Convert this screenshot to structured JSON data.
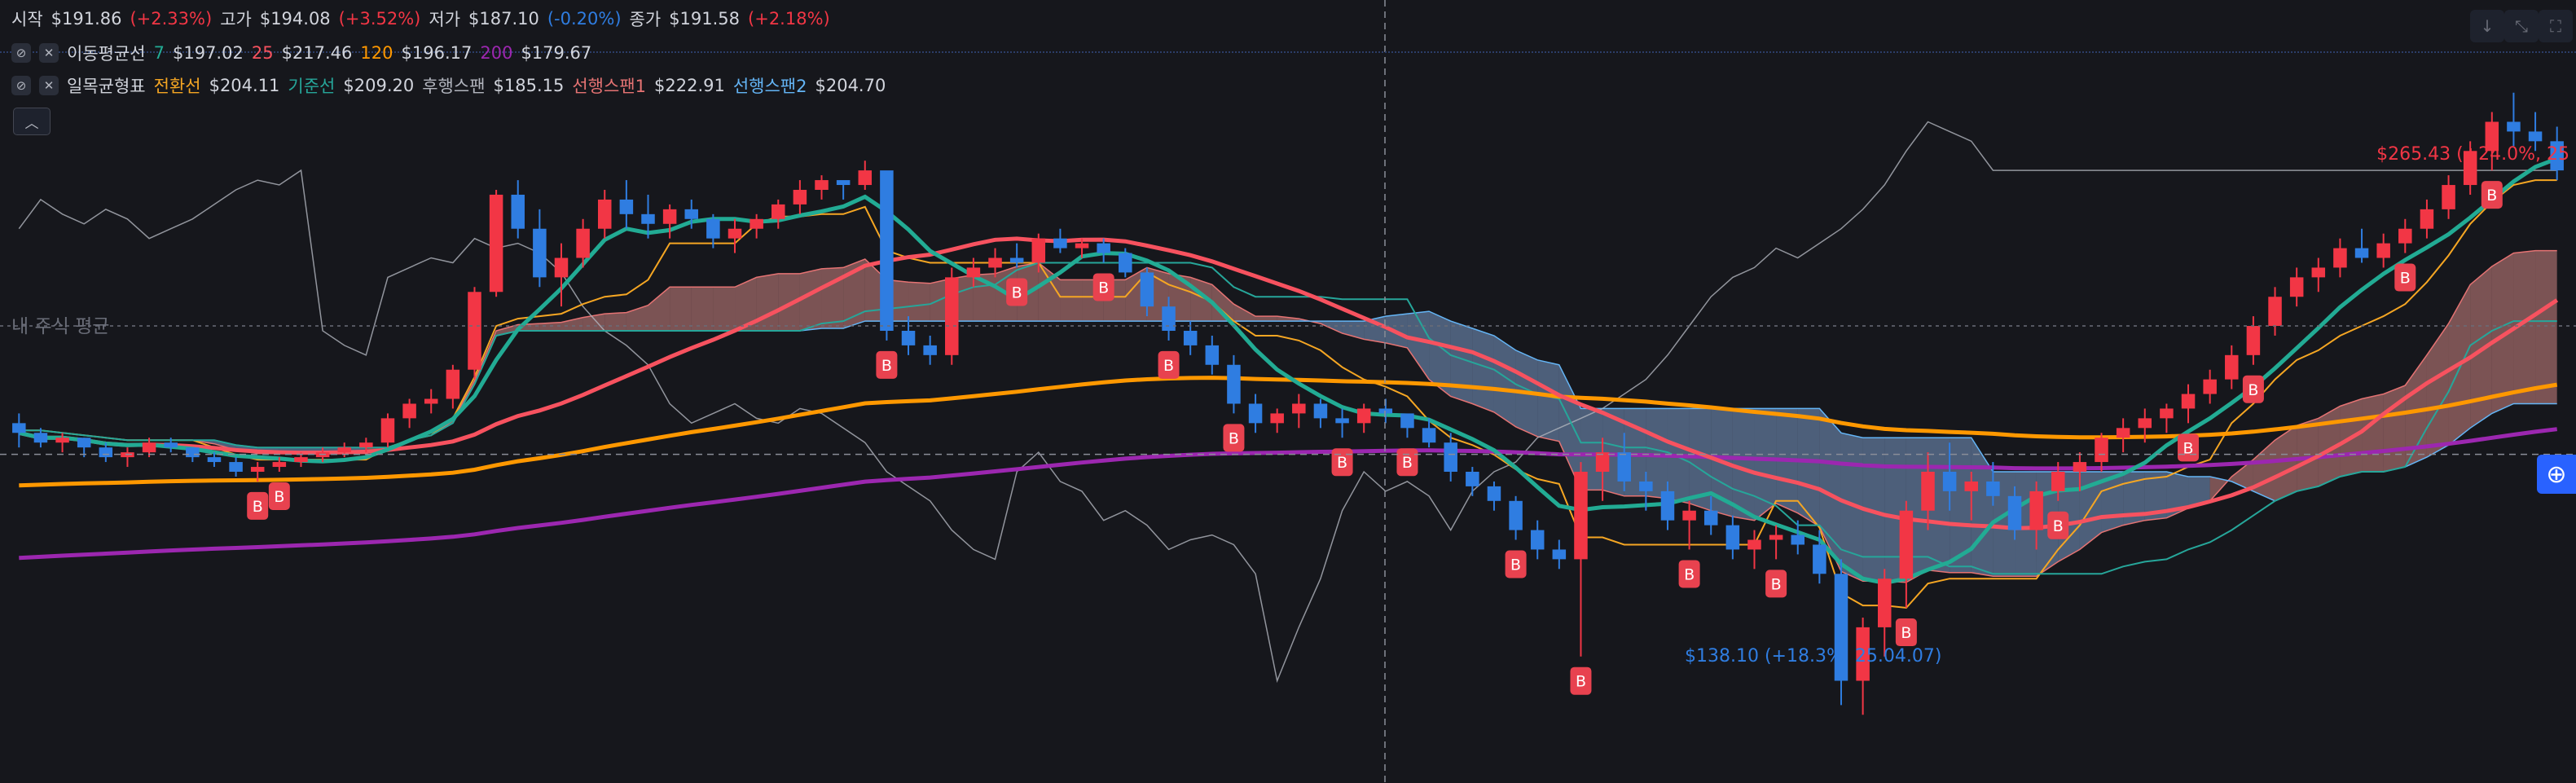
{
  "ohlc": {
    "open_label": "시작",
    "open": "$191.86",
    "open_pct": "(+2.33%)",
    "high_label": "고가",
    "high": "$194.08",
    "high_pct": "(+3.52%)",
    "low_label": "저가",
    "low": "$187.10",
    "low_pct": "(-0.20%)",
    "close_label": "종가",
    "close": "$191.58",
    "close_pct": "(+2.18%)"
  },
  "ma": {
    "name": "이동평균선",
    "p1": "7",
    "v1": "$197.02",
    "p2": "25",
    "v2": "$217.46",
    "p3": "120",
    "v3": "$196.17",
    "p4": "200",
    "v4": "$179.67"
  },
  "ichimoku": {
    "name": "일목균형표",
    "conv_label": "전환선",
    "conv": "$204.11",
    "base_label": "기준선",
    "base": "$209.20",
    "lag_label": "후행스팬",
    "lag": "$185.15",
    "spanA_label": "선행스팬1",
    "spanA": "$222.91",
    "spanB_label": "선행스팬2",
    "spanB": "$204.70"
  },
  "icons": {
    "hide": "eye-off-icon",
    "remove": "close-icon",
    "collapse": "chevron-up-icon",
    "down": "arrow-down-icon",
    "compress": "compress-icon",
    "fullscreen": "fullscreen-icon",
    "add": "plus-icon"
  },
  "annotations": {
    "avg_label": "내 주식 평균",
    "high_marker": "$265.43 (+24.0%, 25",
    "low_marker": "$138.10 (+18.3%, 25.04.07)",
    "buy_marker": "B"
  },
  "colors": {
    "up": "#f23645",
    "down": "#2f7de1",
    "ma7": "#22ab94",
    "ma25": "#f7525f",
    "ma120": "#ff9800",
    "ma200": "#9c27b0",
    "conversion": "#f5a623",
    "base": "#26a69a",
    "lagging": "#b2b5be",
    "spanA_cloud": "#d08584",
    "spanB_cloud": "#7b9ac8"
  },
  "chart_data": {
    "type": "candlestick",
    "ylim": [
      130,
      275
    ],
    "avg_price": 218.0,
    "current_price": 191.58,
    "candles": [
      [
        198,
        200,
        193,
        196
      ],
      [
        196,
        197,
        193,
        194
      ],
      [
        194,
        196,
        192,
        195
      ],
      [
        195,
        195,
        191,
        193
      ],
      [
        193,
        194,
        190,
        191
      ],
      [
        191,
        193,
        189,
        192
      ],
      [
        192,
        195,
        191,
        194
      ],
      [
        194,
        195,
        192,
        193
      ],
      [
        193,
        193,
        190,
        191
      ],
      [
        191,
        192,
        189,
        190
      ],
      [
        190,
        191,
        187,
        188
      ],
      [
        188,
        190,
        186,
        189
      ],
      [
        189,
        191,
        188,
        190
      ],
      [
        190,
        192,
        189,
        191
      ],
      [
        191,
        193,
        190,
        192
      ],
      [
        192,
        194,
        191,
        193
      ],
      [
        193,
        195,
        192,
        194
      ],
      [
        194,
        200,
        193,
        199
      ],
      [
        199,
        203,
        197,
        202
      ],
      [
        202,
        205,
        200,
        203
      ],
      [
        203,
        210,
        201,
        209
      ],
      [
        209,
        226,
        207,
        225
      ],
      [
        225,
        246,
        224,
        245
      ],
      [
        245,
        248,
        236,
        238
      ],
      [
        238,
        242,
        226,
        228
      ],
      [
        228,
        235,
        222,
        232
      ],
      [
        232,
        240,
        230,
        238
      ],
      [
        238,
        246,
        236,
        244
      ],
      [
        244,
        248,
        238,
        241
      ],
      [
        241,
        245,
        236,
        239
      ],
      [
        239,
        243,
        236,
        242
      ],
      [
        242,
        244,
        238,
        240
      ],
      [
        240,
        241,
        234,
        236
      ],
      [
        236,
        240,
        233,
        238
      ],
      [
        238,
        241,
        236,
        240
      ],
      [
        240,
        244,
        238,
        243
      ],
      [
        243,
        248,
        241,
        246
      ],
      [
        246,
        249,
        244,
        248
      ],
      [
        248,
        247,
        244,
        247
      ],
      [
        247,
        252,
        246,
        250
      ],
      [
        250,
        224,
        215,
        217
      ],
      [
        217,
        220,
        212,
        214
      ],
      [
        214,
        216,
        210,
        212
      ],
      [
        212,
        230,
        210,
        228
      ],
      [
        228,
        232,
        226,
        230
      ],
      [
        230,
        234,
        228,
        232
      ],
      [
        232,
        235,
        230,
        231
      ],
      [
        231,
        237,
        229,
        236
      ],
      [
        236,
        238,
        233,
        234
      ],
      [
        234,
        236,
        232,
        235
      ],
      [
        235,
        236,
        231,
        233
      ],
      [
        233,
        234,
        228,
        229
      ],
      [
        229,
        230,
        220,
        222
      ],
      [
        222,
        224,
        215,
        217
      ],
      [
        217,
        219,
        212,
        214
      ],
      [
        214,
        216,
        208,
        210
      ],
      [
        210,
        212,
        200,
        202
      ],
      [
        202,
        204,
        196,
        198
      ],
      [
        198,
        201,
        196,
        200
      ],
      [
        200,
        204,
        197,
        202
      ],
      [
        202,
        203,
        197,
        199
      ],
      [
        199,
        201,
        195,
        198
      ],
      [
        198,
        202,
        196,
        201
      ],
      [
        201,
        203,
        198,
        200
      ],
      [
        200,
        199,
        195,
        197
      ],
      [
        197,
        199,
        193,
        194
      ],
      [
        194,
        196,
        186,
        188
      ],
      [
        188,
        189,
        183,
        185
      ],
      [
        185,
        186,
        180,
        182
      ],
      [
        182,
        183,
        174,
        176
      ],
      [
        176,
        178,
        170,
        172
      ],
      [
        172,
        174,
        168,
        170
      ],
      [
        170,
        190,
        150,
        188
      ],
      [
        188,
        195,
        182,
        192
      ],
      [
        192,
        196,
        184,
        186
      ],
      [
        186,
        188,
        180,
        184
      ],
      [
        184,
        186,
        176,
        178
      ],
      [
        178,
        182,
        172,
        180
      ],
      [
        180,
        183,
        175,
        177
      ],
      [
        177,
        179,
        170,
        172
      ],
      [
        172,
        176,
        168,
        174
      ],
      [
        174,
        177,
        170,
        175
      ],
      [
        175,
        178,
        171,
        173
      ],
      [
        173,
        176,
        165,
        167
      ],
      [
        167,
        170,
        140,
        145
      ],
      [
        145,
        158,
        138,
        156
      ],
      [
        156,
        168,
        150,
        166
      ],
      [
        166,
        182,
        160,
        180
      ],
      [
        180,
        192,
        176,
        188
      ],
      [
        188,
        194,
        180,
        184
      ],
      [
        184,
        188,
        178,
        186
      ],
      [
        186,
        190,
        181,
        183
      ],
      [
        183,
        185,
        174,
        176
      ],
      [
        176,
        186,
        172,
        184
      ],
      [
        184,
        190,
        182,
        188
      ],
      [
        188,
        192,
        184,
        190
      ],
      [
        190,
        196,
        188,
        195
      ],
      [
        195,
        199,
        192,
        197
      ],
      [
        197,
        201,
        194,
        199
      ],
      [
        199,
        202,
        196,
        201
      ],
      [
        201,
        206,
        198,
        204
      ],
      [
        204,
        209,
        202,
        207
      ],
      [
        207,
        214,
        205,
        212
      ],
      [
        212,
        220,
        210,
        218
      ],
      [
        218,
        226,
        216,
        224
      ],
      [
        224,
        230,
        222,
        228
      ],
      [
        228,
        232,
        225,
        230
      ],
      [
        230,
        236,
        228,
        234
      ],
      [
        234,
        238,
        231,
        232
      ],
      [
        232,
        237,
        230,
        235
      ],
      [
        235,
        240,
        233,
        238
      ],
      [
        238,
        244,
        236,
        242
      ],
      [
        242,
        249,
        240,
        247
      ],
      [
        247,
        256,
        245,
        254
      ],
      [
        254,
        262,
        250,
        260
      ],
      [
        260,
        266,
        255,
        258
      ],
      [
        258,
        262,
        254,
        256
      ],
      [
        256,
        259,
        248,
        250
      ]
    ],
    "buy_signals": [
      11,
      12,
      40,
      46,
      50,
      53,
      56,
      61,
      64,
      69,
      72,
      77,
      81,
      87,
      94,
      100,
      103,
      110,
      114,
      118
    ],
    "series": [
      {
        "name": "7"
      },
      {
        "name": "25"
      },
      {
        "name": "120"
      },
      {
        "name": "200"
      }
    ]
  }
}
